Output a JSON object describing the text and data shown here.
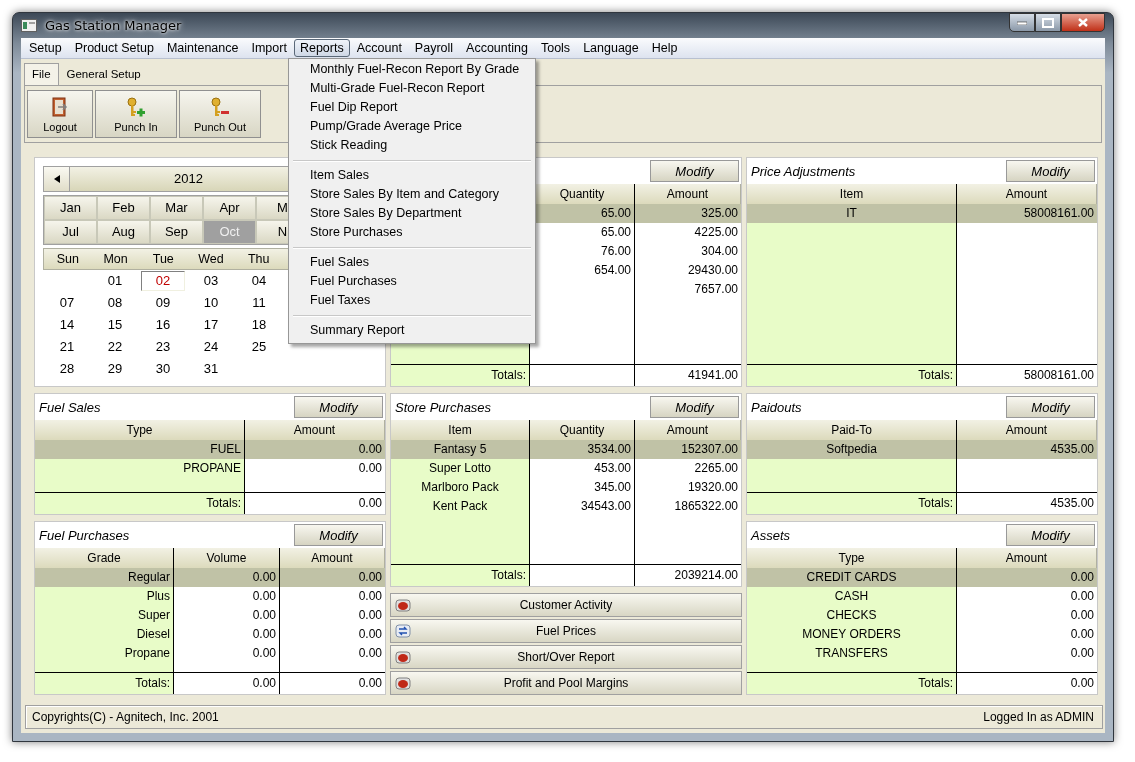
{
  "window": {
    "title": "Gas Station Manager"
  },
  "menu": [
    {
      "label": "Setup",
      "selected": false
    },
    {
      "label": "Product Setup",
      "selected": false
    },
    {
      "label": "Maintenance",
      "selected": false
    },
    {
      "label": "Import",
      "selected": false
    },
    {
      "label": "Reports",
      "selected": true
    },
    {
      "label": "Account",
      "selected": false
    },
    {
      "label": "Payroll",
      "selected": false
    },
    {
      "label": "Accounting",
      "selected": false
    },
    {
      "label": "Tools",
      "selected": false
    },
    {
      "label": "Language",
      "selected": false
    },
    {
      "label": "Help",
      "selected": false
    }
  ],
  "reports_menu": [
    [
      "Monthly Fuel-Recon Report By Grade",
      "Multi-Grade Fuel-Recon Report",
      "Fuel Dip Report",
      "Pump/Grade Average Price",
      "Stick Reading"
    ],
    [
      "Item Sales",
      "Store Sales By Item and Category",
      "Store Sales By Department",
      "Store Purchases"
    ],
    [
      "Fuel Sales",
      "Fuel Purchases",
      "Fuel Taxes"
    ],
    [
      "Summary Report"
    ]
  ],
  "tabs": [
    {
      "label": "File",
      "selected": true
    },
    {
      "label": "General Setup",
      "selected": false
    }
  ],
  "toolbar": [
    {
      "label": "Logout",
      "kind": "logout"
    },
    {
      "label": "Punch In",
      "kind": "punch_in"
    },
    {
      "label": "Punch Out",
      "kind": "punch_out"
    }
  ],
  "calendar": {
    "year": "2012",
    "months": [
      [
        {
          "label": "Jan",
          "selected": false
        },
        {
          "label": "Feb",
          "selected": false
        },
        {
          "label": "Mar",
          "selected": false
        },
        {
          "label": "Apr",
          "selected": false
        },
        {
          "label": "M",
          "selected": false
        }
      ],
      [
        {
          "label": "Jul",
          "selected": false
        },
        {
          "label": "Aug",
          "selected": false
        },
        {
          "label": "Sep",
          "selected": false
        },
        {
          "label": "Oct",
          "selected": true
        },
        {
          "label": "N",
          "selected": false
        }
      ]
    ],
    "weekdays": [
      "Sun",
      "Mon",
      "Tue",
      "Wed",
      "Thu"
    ],
    "weeks": [
      [
        {
          "day": "01",
          "selected": false
        },
        {
          "day": "02",
          "selected": true
        },
        {
          "day": "03",
          "selected": false
        },
        {
          "day": "04",
          "selected": false
        }
      ],
      [
        {
          "day": "07",
          "selected": false
        },
        {
          "day": "08",
          "selected": false
        },
        {
          "day": "09",
          "selected": false
        },
        {
          "day": "10",
          "selected": false
        },
        {
          "day": "11",
          "selected": false
        }
      ],
      [
        {
          "day": "14",
          "selected": false
        },
        {
          "day": "15",
          "selected": false
        },
        {
          "day": "16",
          "selected": false
        },
        {
          "day": "17",
          "selected": false
        },
        {
          "day": "18",
          "selected": false
        }
      ],
      [
        {
          "day": "21",
          "selected": false
        },
        {
          "day": "22",
          "selected": false
        },
        {
          "day": "23",
          "selected": false
        },
        {
          "day": "24",
          "selected": false
        },
        {
          "day": "25",
          "selected": false
        }
      ],
      [
        {
          "day": "28",
          "selected": false
        },
        {
          "day": "29",
          "selected": false
        },
        {
          "day": "30",
          "selected": false
        },
        {
          "day": "31",
          "selected": false
        }
      ]
    ]
  },
  "top_middle_panel": {
    "button": "Modify",
    "columns": [
      {},
      {
        "label": "Quantity"
      },
      {
        "label": "Amount"
      }
    ],
    "rows": [
      {
        "cells": [
          "65.00",
          "325.00"
        ],
        "selected": true
      },
      {
        "cells": [
          "65.00",
          "4225.00"
        ],
        "selected": false
      },
      {
        "cells": [
          "76.00",
          "304.00"
        ],
        "selected": false
      },
      {
        "cells": [
          "654.00",
          "29430.00"
        ],
        "selected": false
      },
      {
        "cells": [
          "",
          "7657.00"
        ],
        "selected": false
      }
    ],
    "totals": {
      "label": "Totals:",
      "values": [
        "41941.00"
      ]
    }
  },
  "price_adjustments": {
    "title": "Price Adjustments",
    "button": "Modify",
    "columns": [
      {
        "label": "Item"
      },
      {
        "label": "Amount"
      }
    ],
    "rows": [
      {
        "cells": [
          "IT",
          "58008161.00"
        ],
        "selected": true
      }
    ],
    "totals": {
      "label": "Totals:",
      "values": [
        "58008161.00"
      ]
    }
  },
  "fuel_sales": {
    "title": "Fuel Sales",
    "button": "Modify",
    "columns": [
      {
        "label": "Type"
      },
      {
        "label": "Amount"
      }
    ],
    "rows": [
      {
        "cells": [
          "FUEL",
          "0.00"
        ],
        "selected": true
      },
      {
        "cells": [
          "PROPANE",
          "0.00"
        ],
        "selected": false
      }
    ],
    "totals": {
      "label": "Totals:",
      "values": [
        "0.00"
      ]
    }
  },
  "store_purchases": {
    "title": "Store Purchases",
    "button": "Modify",
    "columns": [
      {
        "label": "Item"
      },
      {
        "label": "Quantity"
      },
      {
        "label": "Amount"
      }
    ],
    "rows": [
      {
        "cells": [
          "Fantasy 5",
          "3534.00",
          "152307.00"
        ],
        "selected": true
      },
      {
        "cells": [
          "Super Lotto",
          "453.00",
          "2265.00"
        ],
        "selected": false
      },
      {
        "cells": [
          "Marlboro Pack",
          "345.00",
          "19320.00"
        ],
        "selected": false
      },
      {
        "cells": [
          "Kent Pack",
          "34543.00",
          "1865322.00"
        ],
        "selected": false
      }
    ],
    "totals": {
      "label": "Totals:",
      "values": [
        "2039214.00"
      ]
    }
  },
  "paidouts": {
    "title": "Paidouts",
    "button": "Modify",
    "columns": [
      {
        "label": "Paid-To"
      },
      {
        "label": "Amount"
      }
    ],
    "rows": [
      {
        "cells": [
          "Softpedia",
          "4535.00"
        ],
        "selected": true
      }
    ],
    "totals": {
      "label": "Totals:",
      "values": [
        "4535.00"
      ]
    }
  },
  "fuel_purchases": {
    "title": "Fuel Purchases",
    "button": "Modify",
    "columns": [
      {
        "label": "Grade"
      },
      {
        "label": "Volume"
      },
      {
        "label": "Amount"
      }
    ],
    "rows": [
      {
        "cells": [
          "Regular",
          "0.00",
          "0.00"
        ],
        "selected": true
      },
      {
        "cells": [
          "Plus",
          "0.00",
          "0.00"
        ],
        "selected": false
      },
      {
        "cells": [
          "Super",
          "0.00",
          "0.00"
        ],
        "selected": false
      },
      {
        "cells": [
          "Diesel",
          "0.00",
          "0.00"
        ],
        "selected": false
      },
      {
        "cells": [
          "Propane",
          "0.00",
          "0.00"
        ],
        "selected": false
      }
    ],
    "totals": {
      "label": "Totals:",
      "values": [
        "0.00",
        "0.00"
      ]
    }
  },
  "actions": [
    "Customer Activity",
    "Fuel Prices",
    "Short/Over Report",
    "Profit and Pool Margins"
  ],
  "assets": {
    "title": "Assets",
    "button": "Modify",
    "columns": [
      {
        "label": "Type"
      },
      {
        "label": "Amount"
      }
    ],
    "rows": [
      {
        "cells": [
          "CREDIT CARDS",
          "0.00"
        ],
        "selected": true
      },
      {
        "cells": [
          "CASH",
          "0.00"
        ],
        "selected": false
      },
      {
        "cells": [
          "CHECKS",
          "0.00"
        ],
        "selected": false
      },
      {
        "cells": [
          "MONEY ORDERS",
          "0.00"
        ],
        "selected": false
      },
      {
        "cells": [
          "TRANSFERS",
          "0.00"
        ],
        "selected": false
      }
    ],
    "totals": {
      "label": "Totals:",
      "values": [
        "0.00"
      ]
    }
  },
  "status_bar": {
    "copyright": "Copyrights(C) - Agnitech, Inc. 2001",
    "user": "Logged In as ADMIN"
  }
}
